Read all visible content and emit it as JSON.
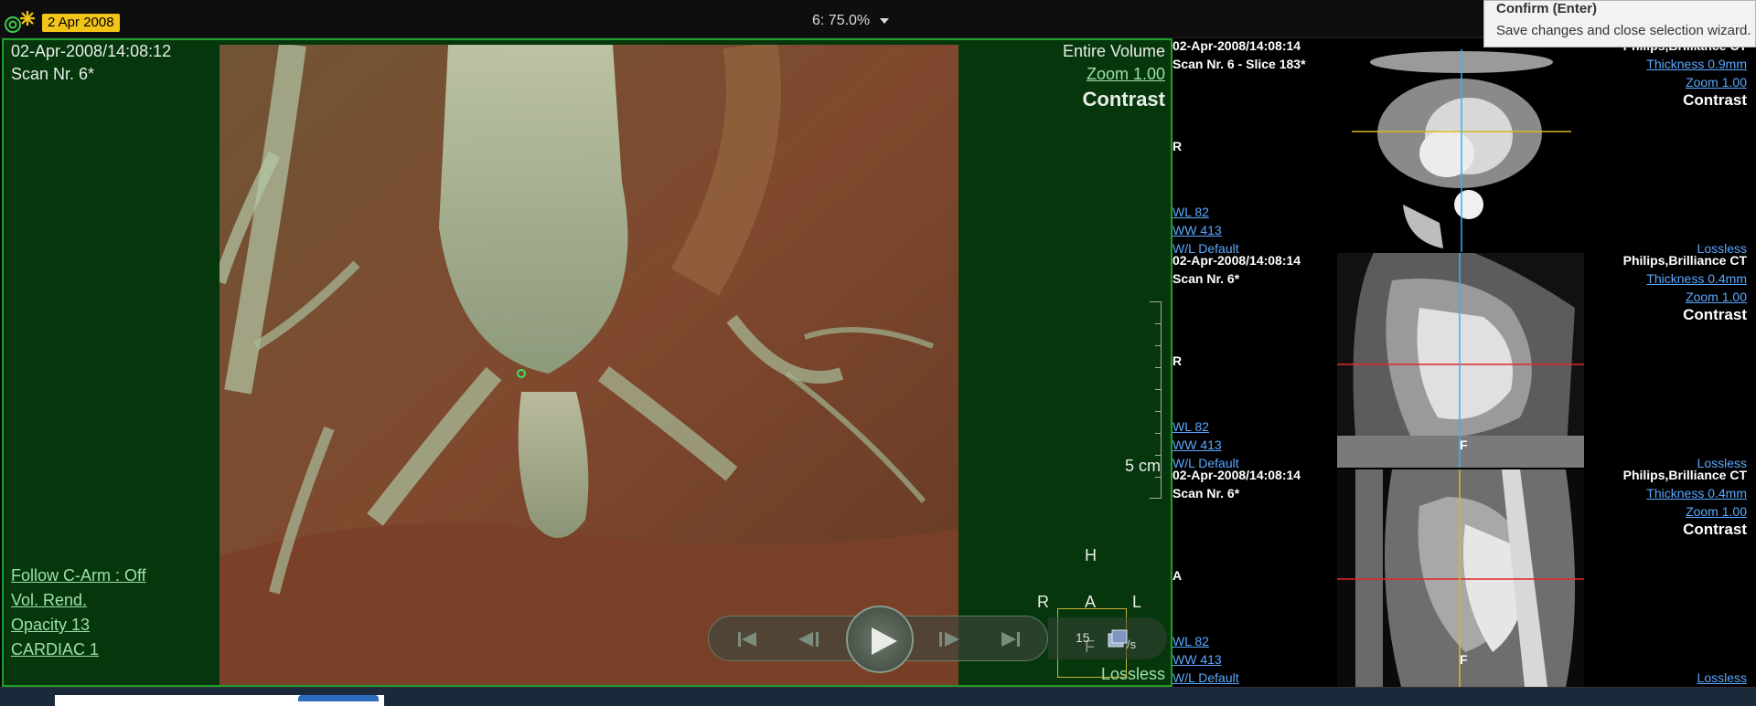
{
  "topbar": {
    "date_badge": "2 Apr 2008",
    "layout_zoom": "6: 75.0%"
  },
  "tooltip": {
    "title": "Confirm (Enter)",
    "description": "Save changes and close selection wizard."
  },
  "main_view": {
    "datetime": "02-Apr-2008/14:08:12",
    "scan": "Scan Nr. 6*",
    "volume": "Entire Volume",
    "zoom": "Zoom 1.00",
    "preset": "Contrast",
    "scale_label": "5 cm",
    "follow_carm": "Follow C-Arm : Off",
    "render_mode": "Vol. Rend.",
    "opacity": "Opacity  13",
    "protocol": "CARDIAC 1",
    "compression": "Lossless",
    "orientation": {
      "top": "H",
      "left": "R",
      "center": "A",
      "right": "L",
      "bottom": "F"
    },
    "playback": {
      "fps": "15",
      "fps_unit": "/s"
    }
  },
  "panels": [
    {
      "datetime": "02-Apr-2008/14:08:14",
      "scan": "Scan Nr. 6 - Slice 183*",
      "manufacturer": "Philips,Brilliance CT",
      "thickness": "Thickness 0.9mm",
      "zoom": "Zoom 1.00",
      "preset": "Contrast",
      "side": "R",
      "wl": "WL     82",
      "ww": "WW    413",
      "wl_preset": "W/L Default",
      "compression": "Lossless",
      "bottom_mark": ""
    },
    {
      "datetime": "02-Apr-2008/14:08:14",
      "scan": "Scan Nr. 6*",
      "manufacturer": "Philips,Brilliance CT",
      "thickness": "Thickness 0.4mm",
      "zoom": "Zoom 1.00",
      "preset": "Contrast",
      "side": "R",
      "wl": "WL     82",
      "ww": "WW    413",
      "wl_preset": "W/L Default",
      "compression": "Lossless",
      "bottom_mark": "F"
    },
    {
      "datetime": "02-Apr-2008/14:08:14",
      "scan": "Scan Nr. 6*",
      "manufacturer": "Philips,Brilliance CT",
      "thickness": "Thickness 0.4mm",
      "zoom": "Zoom 1.00",
      "preset": "Contrast",
      "side": "A",
      "wl": "WL     82",
      "ww": "WW    413",
      "wl_preset": "W/L Default",
      "compression": "Lossless",
      "bottom_mark": "F"
    }
  ],
  "colors": {
    "accent_green": "#1f9e2a",
    "badge_yellow": "#f2c418",
    "link_blue": "#5aa8ff",
    "crosshair_yellow": "#d8b820",
    "crosshair_red": "#e02828",
    "crosshair_cyan": "#30b8f0"
  }
}
